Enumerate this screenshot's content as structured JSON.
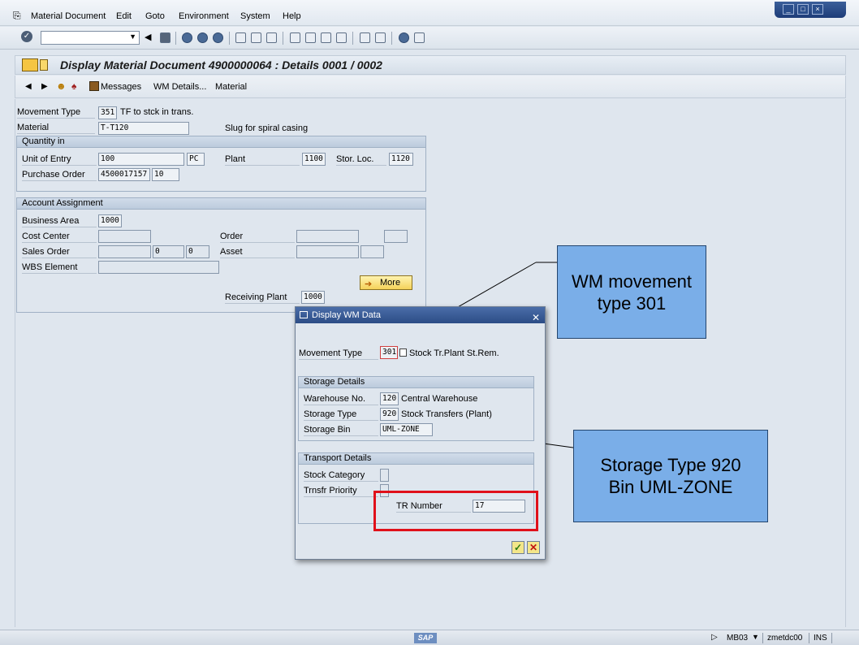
{
  "menu": {
    "items": [
      "Material Document",
      "Edit",
      "Goto",
      "Environment",
      "System",
      "Help"
    ]
  },
  "toolbar": {
    "command_field_value": ""
  },
  "header": {
    "title": "Display Material Document 4900000064 : Details 0001 / 0002"
  },
  "app_toolbar": {
    "messages_label": "Messages",
    "wm_details_label": "WM Details...",
    "material_label": "Material"
  },
  "form": {
    "movement_type": {
      "label": "Movement Type",
      "value": "351",
      "description": "TF to stck in trans."
    },
    "material": {
      "label": "Material",
      "value": "T-T120",
      "description": "Slug for spiral casing"
    },
    "quantity_group": {
      "title": "Quantity in",
      "unit_of_entry": {
        "label": "Unit of Entry",
        "value": "100",
        "unit": "PC"
      },
      "plant": {
        "label": "Plant",
        "value": "1100"
      },
      "stor_loc": {
        "label": "Stor. Loc.",
        "value": "1120"
      },
      "purchase_order": {
        "label": "Purchase Order",
        "value": "4500017157",
        "item": "10"
      }
    },
    "account_group": {
      "title": "Account Assignment",
      "business_area": {
        "label": "Business Area",
        "value": "1000"
      },
      "cost_center": {
        "label": "Cost Center",
        "value": ""
      },
      "order": {
        "label": "Order",
        "value": ""
      },
      "sales_order": {
        "label": "Sales Order",
        "value": "",
        "item": "0",
        "schedule": "0"
      },
      "asset": {
        "label": "Asset",
        "value": ""
      },
      "wbs_element": {
        "label": "WBS Element",
        "value": ""
      },
      "more_label": "More",
      "receiving_plant": {
        "label": "Receiving Plant",
        "value": "1000"
      }
    }
  },
  "dialog": {
    "title": "Display WM Data",
    "movement_type": {
      "label": "Movement Type",
      "value": "301",
      "description": "Stock Tr.Plant St.Rem."
    },
    "storage_details": {
      "title": "Storage Details",
      "warehouse_no": {
        "label": "Warehouse No.",
        "value": "120",
        "description": "Central Warehouse"
      },
      "storage_type": {
        "label": "Storage Type",
        "value": "920",
        "description": "Stock Transfers (Plant)"
      },
      "storage_bin": {
        "label": "Storage Bin",
        "value": "UML-ZONE"
      }
    },
    "transport_details": {
      "title": "Transport Details",
      "stock_category": {
        "label": "Stock Category",
        "value": ""
      },
      "trnsfr_priority": {
        "label": "Trnsfr Priority",
        "value": ""
      },
      "tr_number": {
        "label": "TR Number",
        "value": "17"
      }
    }
  },
  "annotations": {
    "callout1": "WM movement type 301",
    "callout2": "Storage Type 920 Bin UML-ZONE"
  },
  "statusbar": {
    "logo": "SAP",
    "transaction": "MB03",
    "server": "zmetdc00",
    "mode": "INS"
  },
  "colors": {
    "dialog_title": "#2c4d86",
    "callout_fill": "#7aaee8",
    "highlight_red": "#e0101a"
  }
}
